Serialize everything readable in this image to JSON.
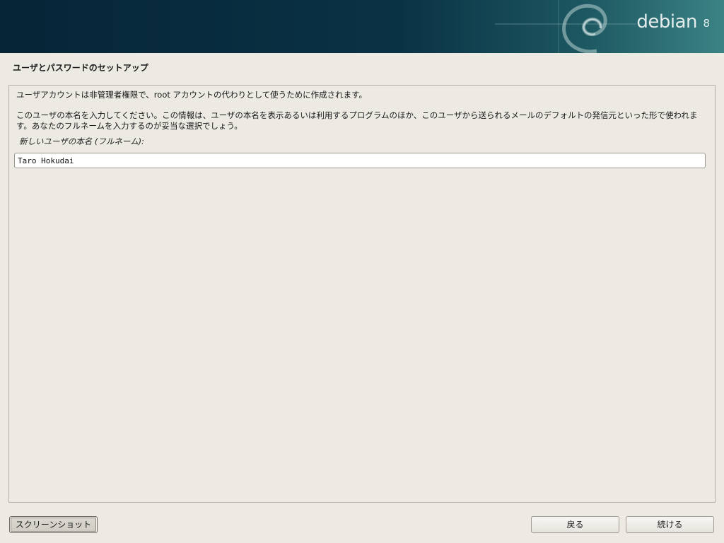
{
  "banner": {
    "logo_text": "debian",
    "logo_version": "8"
  },
  "page": {
    "title": "ユーザとパスワードのセットアップ"
  },
  "content": {
    "paragraph_1": "ユーザアカウントは非管理者権限で、root アカウントの代わりとして使うために作成されます。",
    "paragraph_2": "このユーザの本名を入力してください。この情報は、ユーザの本名を表示あるいは利用するプログラムのほか、このユーザから送られるメールのデフォルトの発信元といった形で使われます。あなたのフルネームを入力するのが妥当な選択でしょう。",
    "field_label": "新しいユーザの本名 (フルネーム):",
    "fullname_value": "Taro Hokudai"
  },
  "buttons": {
    "screenshot": "スクリーンショット",
    "back": "戻る",
    "continue": "続ける"
  },
  "colors": {
    "banner_dark": "#062537",
    "banner_light": "#3b8385",
    "background": "#edeae4"
  }
}
